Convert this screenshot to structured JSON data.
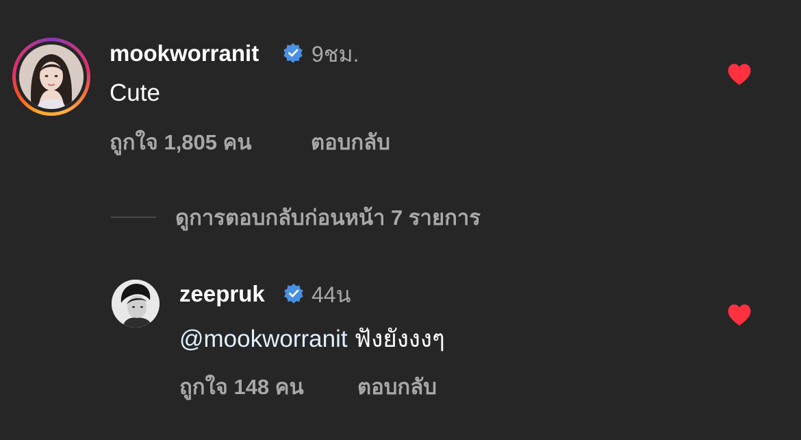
{
  "comments": [
    {
      "username": "mookworranit",
      "verified": true,
      "timestamp": "9ชม.",
      "text": "Cute",
      "likes_text": "ถูกใจ 1,805 คน",
      "reply_label": "ตอบกลับ",
      "liked": true,
      "has_story_ring": true
    },
    {
      "username": "zeepruk",
      "verified": true,
      "timestamp": "44น",
      "mention": "@mookworranit",
      "text": " ฟังยังงงๆ",
      "likes_text": "ถูกใจ 148 คน",
      "reply_label": "ตอบกลับ",
      "liked": true,
      "has_story_ring": false
    }
  ],
  "view_previous_replies": "ดูการตอบกลับก่อนหน้า 7 รายการ",
  "colors": {
    "background": "#262626",
    "text_primary": "#ffffff",
    "text_secondary": "#a8a8a8",
    "heart": "#ff3040",
    "verified": "#4a90e2",
    "mention": "#e0f1ff"
  },
  "icons": {
    "verified": "verified-badge-icon",
    "heart": "heart-filled-icon"
  }
}
